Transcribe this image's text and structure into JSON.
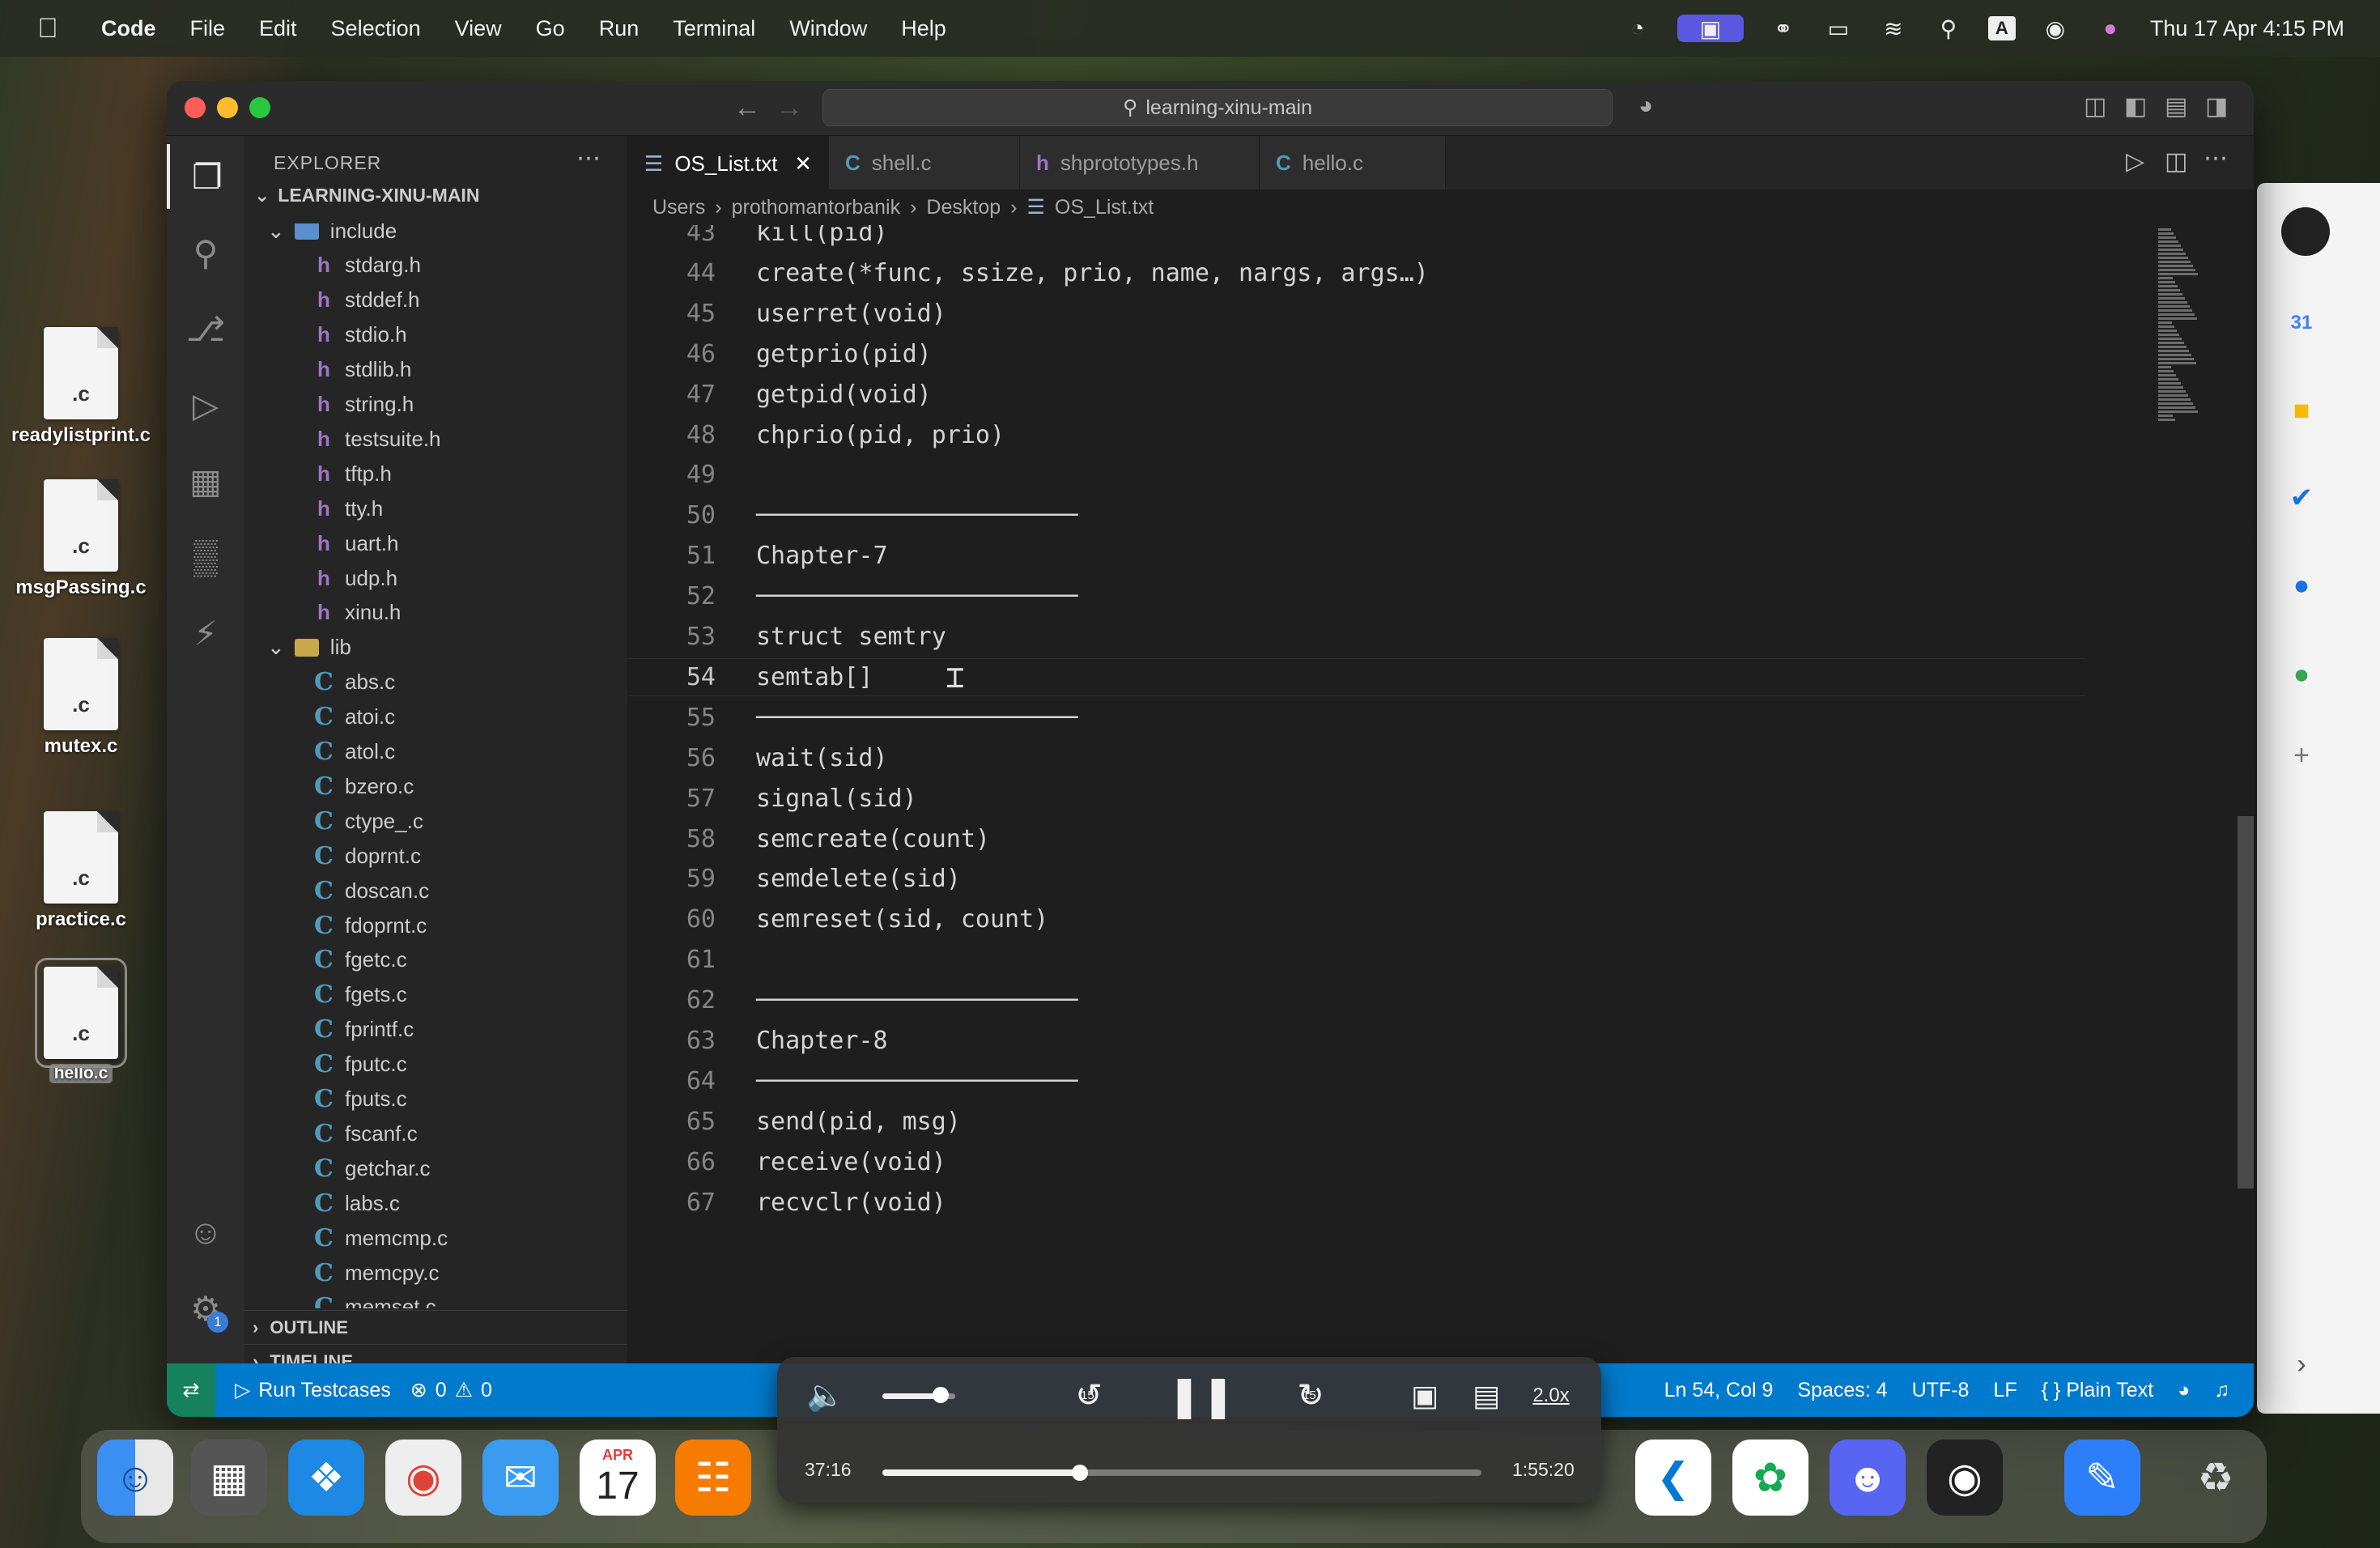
{
  "menubar": {
    "apple": "",
    "items": [
      "Code",
      "File",
      "Edit",
      "Selection",
      "View",
      "Go",
      "Run",
      "Terminal",
      "Window",
      "Help"
    ],
    "clock": "Thu 17 Apr  4:15 PM"
  },
  "desktop": {
    "files": [
      {
        "name": "readylistprint.c",
        "ext": ".c"
      },
      {
        "name": "msgPassing.c",
        "ext": ".c"
      },
      {
        "name": "mutex.c",
        "ext": ".c"
      },
      {
        "name": "practice.c",
        "ext": ".c"
      },
      {
        "name": "hello.c",
        "ext": ".c"
      }
    ]
  },
  "window": {
    "command_center": "learning-xinu-main",
    "explorer": {
      "title": "EXPLORER",
      "root": "LEARNING-XINU-MAIN",
      "tree": [
        {
          "type": "folder",
          "label": "include",
          "open": true
        },
        {
          "type": "h",
          "label": "stdarg.h"
        },
        {
          "type": "h",
          "label": "stddef.h"
        },
        {
          "type": "h",
          "label": "stdio.h"
        },
        {
          "type": "h",
          "label": "stdlib.h"
        },
        {
          "type": "h",
          "label": "string.h"
        },
        {
          "type": "h",
          "label": "testsuite.h"
        },
        {
          "type": "h",
          "label": "tftp.h"
        },
        {
          "type": "h",
          "label": "tty.h"
        },
        {
          "type": "h",
          "label": "uart.h"
        },
        {
          "type": "h",
          "label": "udp.h"
        },
        {
          "type": "h",
          "label": "xinu.h"
        },
        {
          "type": "folder",
          "label": "lib",
          "open": true
        },
        {
          "type": "c",
          "label": "abs.c"
        },
        {
          "type": "c",
          "label": "atoi.c"
        },
        {
          "type": "c",
          "label": "atol.c"
        },
        {
          "type": "c",
          "label": "bzero.c"
        },
        {
          "type": "c",
          "label": "ctype_.c"
        },
        {
          "type": "c",
          "label": "doprnt.c"
        },
        {
          "type": "c",
          "label": "doscan.c"
        },
        {
          "type": "c",
          "label": "fdoprnt.c"
        },
        {
          "type": "c",
          "label": "fgetc.c"
        },
        {
          "type": "c",
          "label": "fgets.c"
        },
        {
          "type": "c",
          "label": "fprintf.c"
        },
        {
          "type": "c",
          "label": "fputc.c"
        },
        {
          "type": "c",
          "label": "fputs.c"
        },
        {
          "type": "c",
          "label": "fscanf.c"
        },
        {
          "type": "c",
          "label": "getchar.c"
        },
        {
          "type": "c",
          "label": "labs.c"
        },
        {
          "type": "c",
          "label": "memcmp.c"
        },
        {
          "type": "c",
          "label": "memcpy.c"
        },
        {
          "type": "c",
          "label": "memset.c"
        }
      ],
      "outline": "OUTLINE",
      "timeline": "TIMELINE"
    },
    "tabs": [
      {
        "label": "OS_List.txt",
        "icon": "txt",
        "active": true
      },
      {
        "label": "shell.c",
        "icon": "C",
        "active": false
      },
      {
        "label": "shprototypes.h",
        "icon": "h",
        "active": false
      },
      {
        "label": "hello.c",
        "icon": "C",
        "active": false
      }
    ],
    "breadcrumb": [
      "Users",
      "prothomantorbanik",
      "Desktop",
      "OS_List.txt"
    ],
    "editor": {
      "lines": [
        {
          "n": "43",
          "text": "kill(pid)"
        },
        {
          "n": "44",
          "text": "create(*func, ssize, prio, name, nargs, args…)"
        },
        {
          "n": "45",
          "text": "userret(void)"
        },
        {
          "n": "46",
          "text": "getprio(pid)"
        },
        {
          "n": "47",
          "text": "getpid(void)"
        },
        {
          "n": "48",
          "text": "chprio(pid, prio)"
        },
        {
          "n": "49",
          "text": ""
        },
        {
          "n": "50",
          "text": "──────────────────────"
        },
        {
          "n": "51",
          "text": "Chapter-7"
        },
        {
          "n": "52",
          "text": "──────────────────────"
        },
        {
          "n": "53",
          "text": "struct semtry"
        },
        {
          "n": "54",
          "text": "semtab[]"
        },
        {
          "n": "55",
          "text": "──────────────────────"
        },
        {
          "n": "56",
          "text": "wait(sid)"
        },
        {
          "n": "57",
          "text": "signal(sid)"
        },
        {
          "n": "58",
          "text": "semcreate(count)"
        },
        {
          "n": "59",
          "text": "semdelete(sid)"
        },
        {
          "n": "60",
          "text": "semreset(sid, count)"
        },
        {
          "n": "61",
          "text": ""
        },
        {
          "n": "62",
          "text": "──────────────────────"
        },
        {
          "n": "63",
          "text": "Chapter-8"
        },
        {
          "n": "64",
          "text": "──────────────────────"
        },
        {
          "n": "65",
          "text": "send(pid, msg)"
        },
        {
          "n": "66",
          "text": "receive(void)"
        },
        {
          "n": "67",
          "text": "recvclr(void)"
        }
      ],
      "current_line": "54"
    },
    "statusbar": {
      "task": "Run Testcases",
      "errors": "0",
      "warnings": "0",
      "position": "Ln 54, Col 9",
      "spaces": "Spaces: 4",
      "encoding": "UTF-8",
      "eol": "LF",
      "language": "Plain Text",
      "settings_badge": "1"
    }
  },
  "player": {
    "elapsed": "37:16",
    "remaining": "1:55:20",
    "speed": "2.0x",
    "skip_back": "15",
    "skip_forward": "15",
    "volume": 0.8,
    "progress": 0.33
  },
  "calendar": {
    "month": "APR",
    "day": "17"
  },
  "sidepanel": {
    "calendar_day": "31"
  },
  "colors": {
    "vscode_blue": "#007acc",
    "editor_bg": "#1e1e1e",
    "sidebar_bg": "#252526",
    "c_icon": "#519aba",
    "h_icon": "#a074c4"
  }
}
